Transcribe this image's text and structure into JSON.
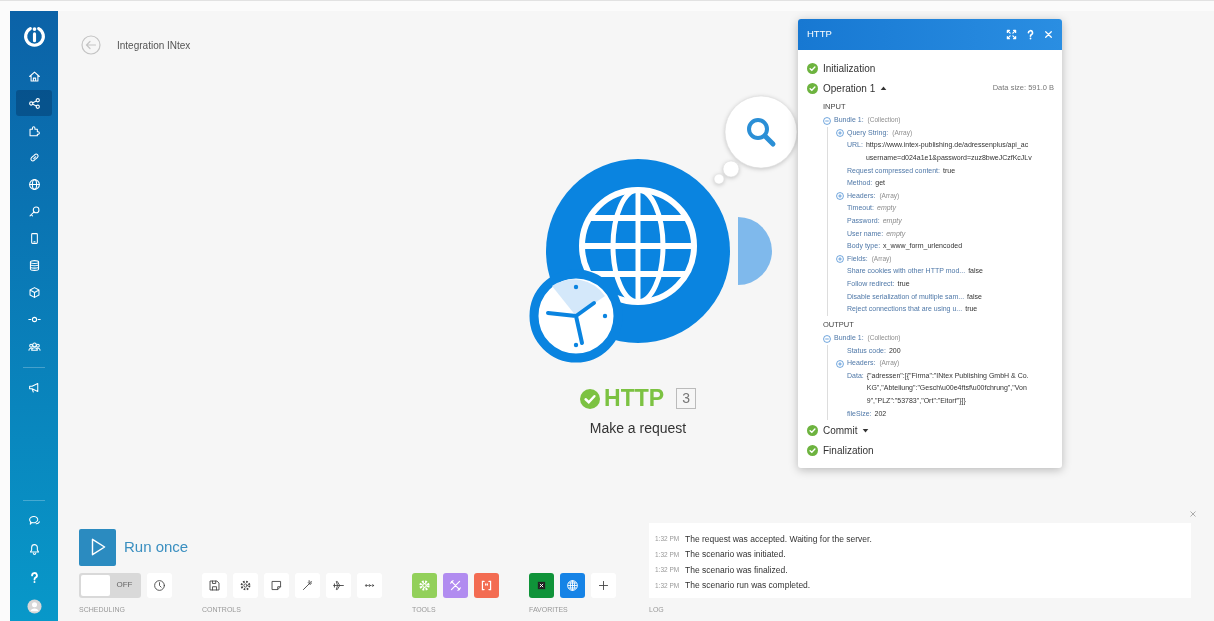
{
  "sidebar": {
    "items": [
      {
        "selected": false
      },
      {
        "selected": true
      },
      {
        "selected": false
      },
      {
        "selected": false
      },
      {
        "selected": false
      },
      {
        "selected": false
      },
      {
        "selected": false
      },
      {
        "selected": false
      },
      {
        "selected": false
      },
      {
        "selected": false
      },
      {
        "selected": false
      },
      {
        "selected": false
      }
    ]
  },
  "breadcrumb": {
    "title": "Integration INtex"
  },
  "module": {
    "name": "HTTP",
    "number": "3",
    "subtitle": "Make a request",
    "ok": true
  },
  "inspector": {
    "title": "HTTP",
    "phases": [
      {
        "label": "Initialization",
        "done": true
      },
      {
        "label": "Operation 1",
        "done": true,
        "expanded": true,
        "data_size": "Data size: 591.0 B",
        "input": {
          "heading": "INPUT",
          "tree": [
            {
              "kind": "group",
              "label": "Bundle 1:",
              "type": "(Collection)",
              "expanded": true,
              "children": [
                {
                  "kind": "group",
                  "label": "Query String:",
                  "type": "(Array)",
                  "expanded": false
                },
                {
                  "kind": "value",
                  "label": "URL:",
                  "value": "https://www.intex-publishing.de/adressenplus/api_ac\nusername=d024a1e1&password=zuz8bweJCzfKcJLv"
                },
                {
                  "kind": "value",
                  "label": "Request compressed content:",
                  "value": "true"
                },
                {
                  "kind": "value",
                  "label": "Method:",
                  "value": "get"
                },
                {
                  "kind": "group",
                  "label": "Headers:",
                  "type": "(Array)",
                  "expanded": false
                },
                {
                  "kind": "empty",
                  "label": "Timeout:",
                  "value": "empty"
                },
                {
                  "kind": "empty",
                  "label": "Password:",
                  "value": "empty"
                },
                {
                  "kind": "empty",
                  "label": "User name:",
                  "value": "empty"
                },
                {
                  "kind": "value",
                  "label": "Body type:",
                  "value": "x_www_form_urlencoded"
                },
                {
                  "kind": "group",
                  "label": "Fields:",
                  "type": "(Array)",
                  "expanded": false
                },
                {
                  "kind": "value",
                  "label": "Share cookies with other HTTP mod...",
                  "value": "false"
                },
                {
                  "kind": "value",
                  "label": "Follow redirect:",
                  "value": "true"
                },
                {
                  "kind": "value",
                  "label": "Disable serialization of multiple sam...",
                  "value": "false"
                },
                {
                  "kind": "value",
                  "label": "Reject connections that are using u...",
                  "value": "true"
                }
              ]
            }
          ]
        },
        "output": {
          "heading": "OUTPUT",
          "tree": [
            {
              "kind": "group",
              "label": "Bundle 1:",
              "type": "(Collection)",
              "expanded": true,
              "children": [
                {
                  "kind": "value",
                  "label": "Status code:",
                  "value": "200"
                },
                {
                  "kind": "group",
                  "label": "Headers:",
                  "type": "(Array)",
                  "expanded": false
                },
                {
                  "kind": "value",
                  "label": "Data:",
                  "value": "{\"adressen\":[{\"Firma\":\"INtex Publishing GmbH & Co.\nKG\",\"Abteilung\":\"Gesch\\u00e4ftsf\\u00fchrung\",\"Von\n9\",\"PLZ\":\"53783\",\"Ort\":\"Eitorf\"}]}"
                },
                {
                  "kind": "value",
                  "label": "fileSize:",
                  "value": "202"
                }
              ]
            }
          ]
        }
      },
      {
        "label": "Commit",
        "done": true,
        "expanded": false
      },
      {
        "label": "Finalization",
        "done": true
      }
    ]
  },
  "run": {
    "label": "Run once"
  },
  "scheduling": {
    "toggle_label": "OFF",
    "on": false,
    "caption": "SCHEDULING"
  },
  "controls": {
    "caption": "CONTROLS"
  },
  "tools": {
    "caption": "TOOLS",
    "items": [
      {
        "color": "#92d05a"
      },
      {
        "color": "#b18cf0"
      },
      {
        "color": "#f36c52"
      }
    ]
  },
  "favorites": {
    "caption": "FAVORITES",
    "items": [
      {
        "color": "#0f9339"
      },
      {
        "color": "#1683e6"
      }
    ]
  },
  "log": {
    "caption": "LOG",
    "entries": [
      {
        "time": "1:32 PM",
        "message": "The request was accepted. Waiting for the server."
      },
      {
        "time": "1:32 PM",
        "message": "The scenario was initiated."
      },
      {
        "time": "1:32 PM",
        "message": "The scenario was finalized."
      },
      {
        "time": "1:32 PM",
        "message": "The scenario run was completed."
      }
    ]
  }
}
